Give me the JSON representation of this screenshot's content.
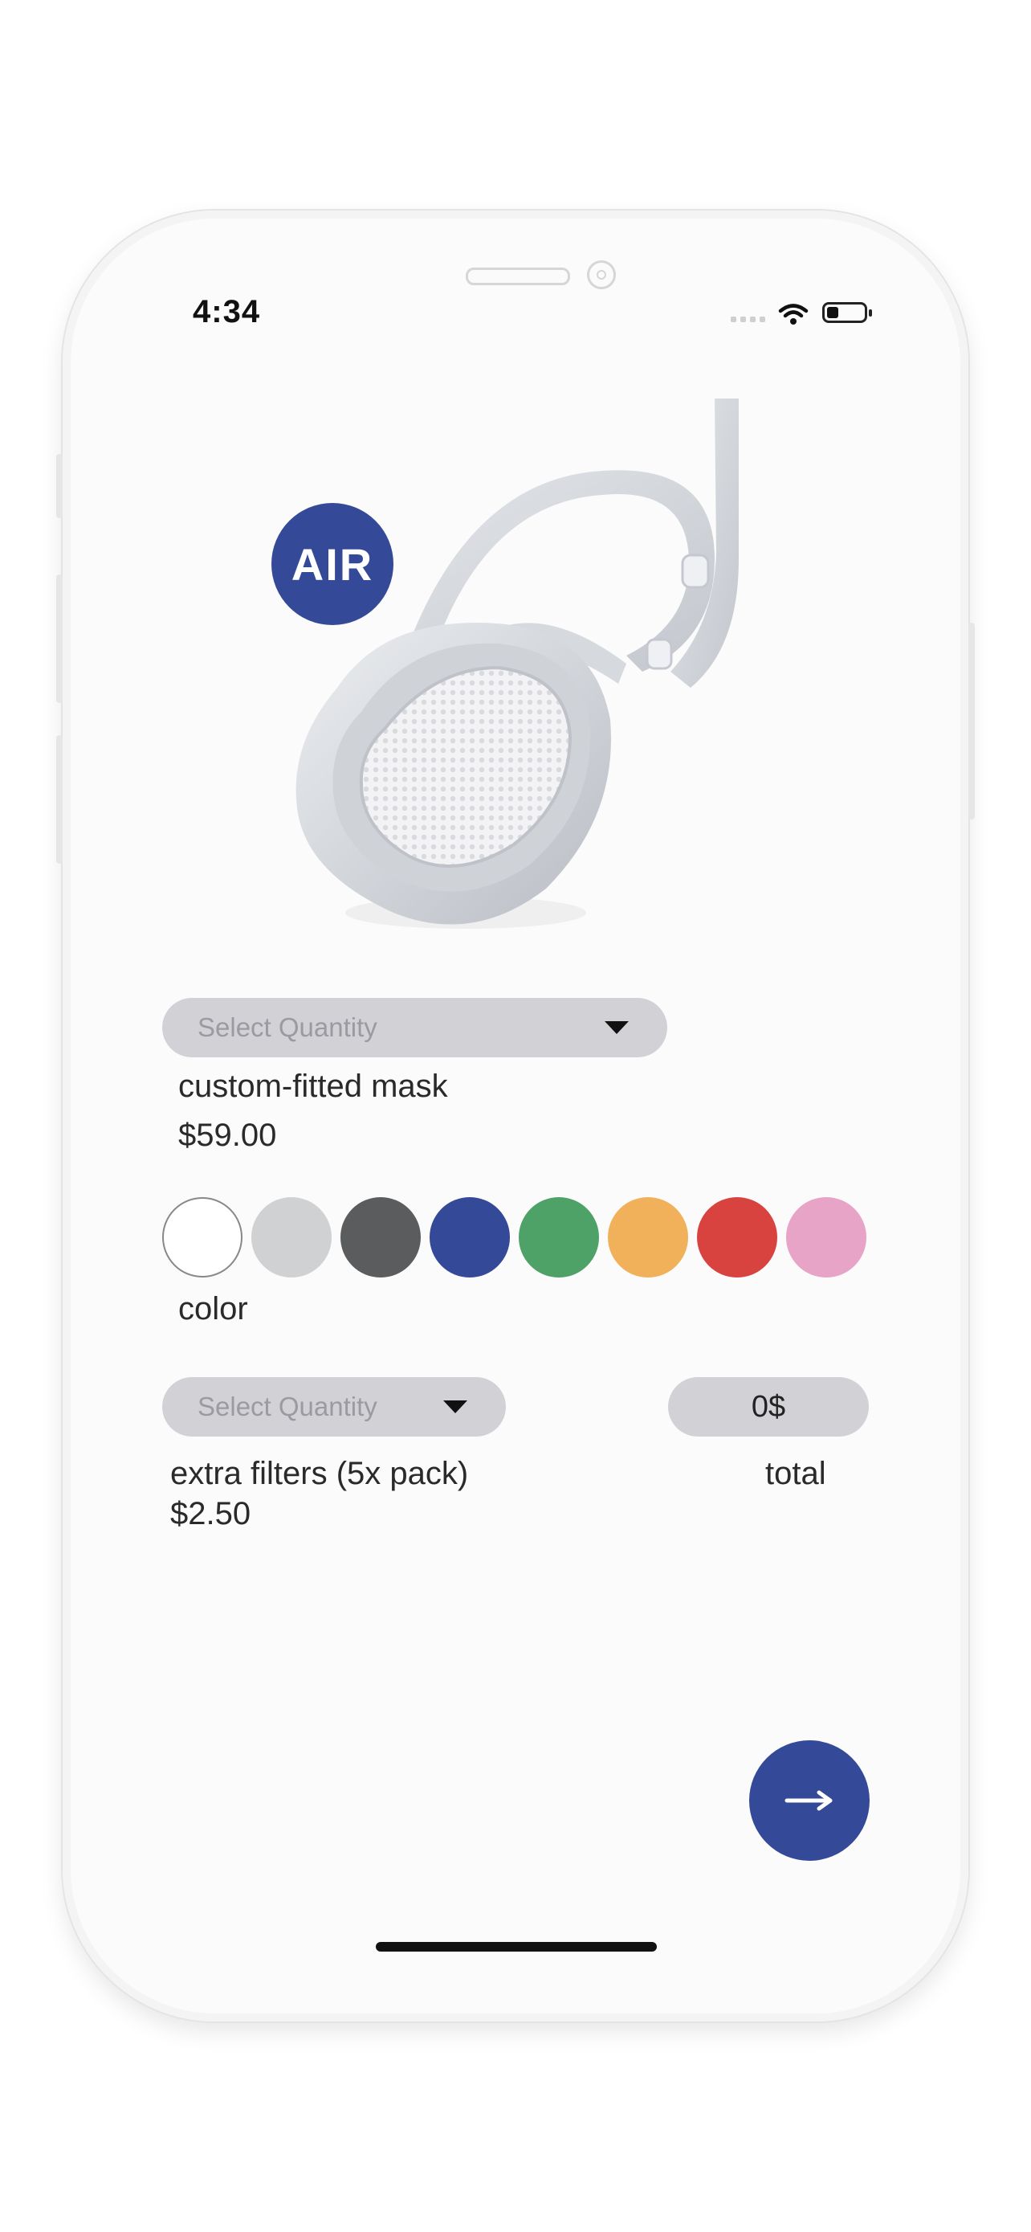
{
  "status_bar": {
    "time": "4:34"
  },
  "brand": {
    "logo_text": "AIR",
    "color": "#344a99"
  },
  "product": {
    "quantity_placeholder": "Select Quantity",
    "name": "custom-fitted mask",
    "price": "$59.00"
  },
  "color_picker": {
    "label": "color",
    "swatches": [
      "#ffffff",
      "#d0d1d3",
      "#5b5c5e",
      "#344a99",
      "#4fa267",
      "#f0b15a",
      "#d8433f",
      "#e8a4c6"
    ]
  },
  "filters": {
    "quantity_placeholder": "Select Quantity",
    "name": "extra filters (5x pack)",
    "price": "$2.50"
  },
  "total": {
    "value": "0$",
    "label": "total"
  },
  "next_button": {
    "icon": "arrow-right-icon"
  }
}
